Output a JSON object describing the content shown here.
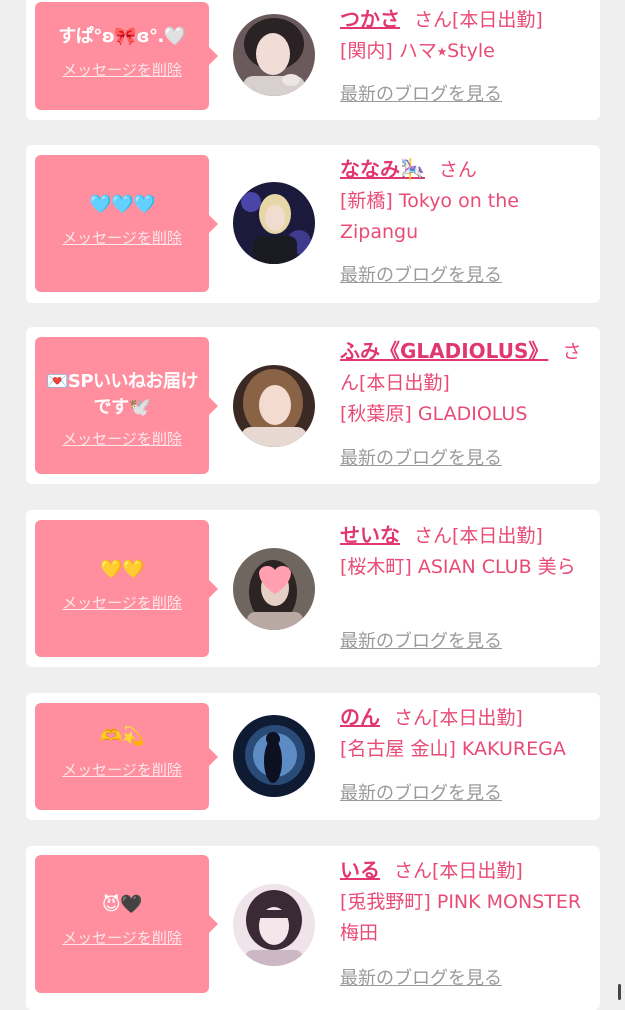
{
  "items": [
    {
      "message": "すぱ°ʚ🎀ɞ°.🤍",
      "delete_label": "メッセージを削除",
      "name": "つかさ",
      "san": "さん",
      "status": "[本日出勤]",
      "store": "[関内] ハマ⭑Style",
      "blog_label": "最新のブログを見る"
    },
    {
      "message": "🩵🩵🩵",
      "delete_label": "メッセージを削除",
      "name": "ななみ🎠",
      "san": "さん",
      "status": "",
      "store": "[新橋] Tokyo on the Zipangu",
      "blog_label": "最新のブログを見る"
    },
    {
      "message": "💌SPいいねお届けです🕊️",
      "delete_label": "メッセージを削除",
      "name": "ふみ《GLADIOLUS》",
      "san": "さん",
      "status": "[本日出勤]",
      "store": "[秋葉原] GLADIOLUS",
      "blog_label": "最新のブログを見る"
    },
    {
      "message": "💛💛",
      "delete_label": "メッセージを削除",
      "name": "せいな",
      "san": "さん",
      "status": "[本日出勤]",
      "store": "[桜木町] ASIAN CLUB 美ら",
      "blog_label": "最新のブログを見る"
    },
    {
      "message": "🫶💫",
      "delete_label": "メッセージを削除",
      "name": "のん",
      "san": "さん",
      "status": "[本日出勤]",
      "store": "[名古屋 金山] KAKUREGA",
      "blog_label": "最新のブログを見る"
    },
    {
      "message": "😈🖤",
      "delete_label": "メッセージを削除",
      "name": "いる",
      "san": "さん",
      "status": "[本日出勤]",
      "store": "[兎我野町] PINK MONSTER梅田",
      "blog_label": "最新のブログを見る"
    }
  ]
}
